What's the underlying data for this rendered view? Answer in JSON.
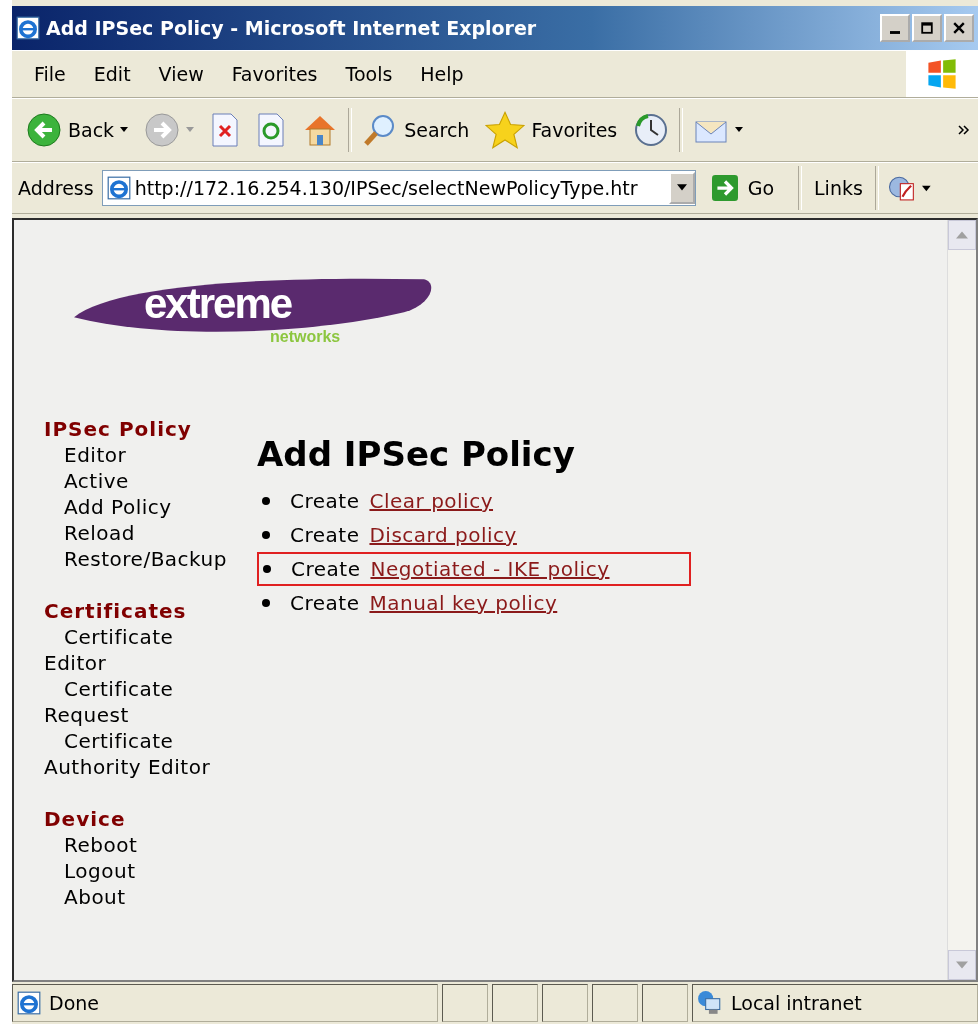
{
  "window": {
    "title": "Add IPSec Policy - Microsoft Internet Explorer"
  },
  "menu": [
    "File",
    "Edit",
    "View",
    "Favorites",
    "Tools",
    "Help"
  ],
  "toolbar": [
    {
      "kind": "back",
      "label": "Back"
    },
    {
      "kind": "forward"
    },
    {
      "kind": "stop"
    },
    {
      "kind": "refresh"
    },
    {
      "kind": "home"
    },
    {
      "kind": "search",
      "label": "Search"
    },
    {
      "kind": "favorites",
      "label": "Favorites"
    },
    {
      "kind": "history"
    },
    {
      "kind": "mail"
    }
  ],
  "address": {
    "label": "Address",
    "value": "http://172.16.254.130/IPSec/selectNewPolicyType.htr",
    "go": "Go",
    "links": "Links"
  },
  "logo": {
    "word": "extreme",
    "sub": "networks"
  },
  "sidebar": [
    {
      "heading": "IPSec Policy",
      "items": [
        "Editor",
        "Active",
        "Add Policy",
        "Reload",
        "Restore/Backup"
      ]
    },
    {
      "heading": "Certificates",
      "items": [
        "Certificate Editor",
        "Certificate Request",
        "Certificate Authority Editor"
      ]
    },
    {
      "heading": "Device",
      "items": [
        "Reboot",
        "Logout",
        "About"
      ]
    }
  ],
  "page": {
    "title": "Add IPSec Policy",
    "options": [
      {
        "prefix": "Create",
        "link": "Clear policy",
        "highlighted": false
      },
      {
        "prefix": "Create",
        "link": "Discard policy",
        "highlighted": false
      },
      {
        "prefix": "Create",
        "link": "Negotiated - IKE policy",
        "highlighted": true
      },
      {
        "prefix": "Create",
        "link": "Manual key policy",
        "highlighted": false
      }
    ]
  },
  "status_bar": {
    "text": "Done",
    "zone": "Local intranet"
  }
}
